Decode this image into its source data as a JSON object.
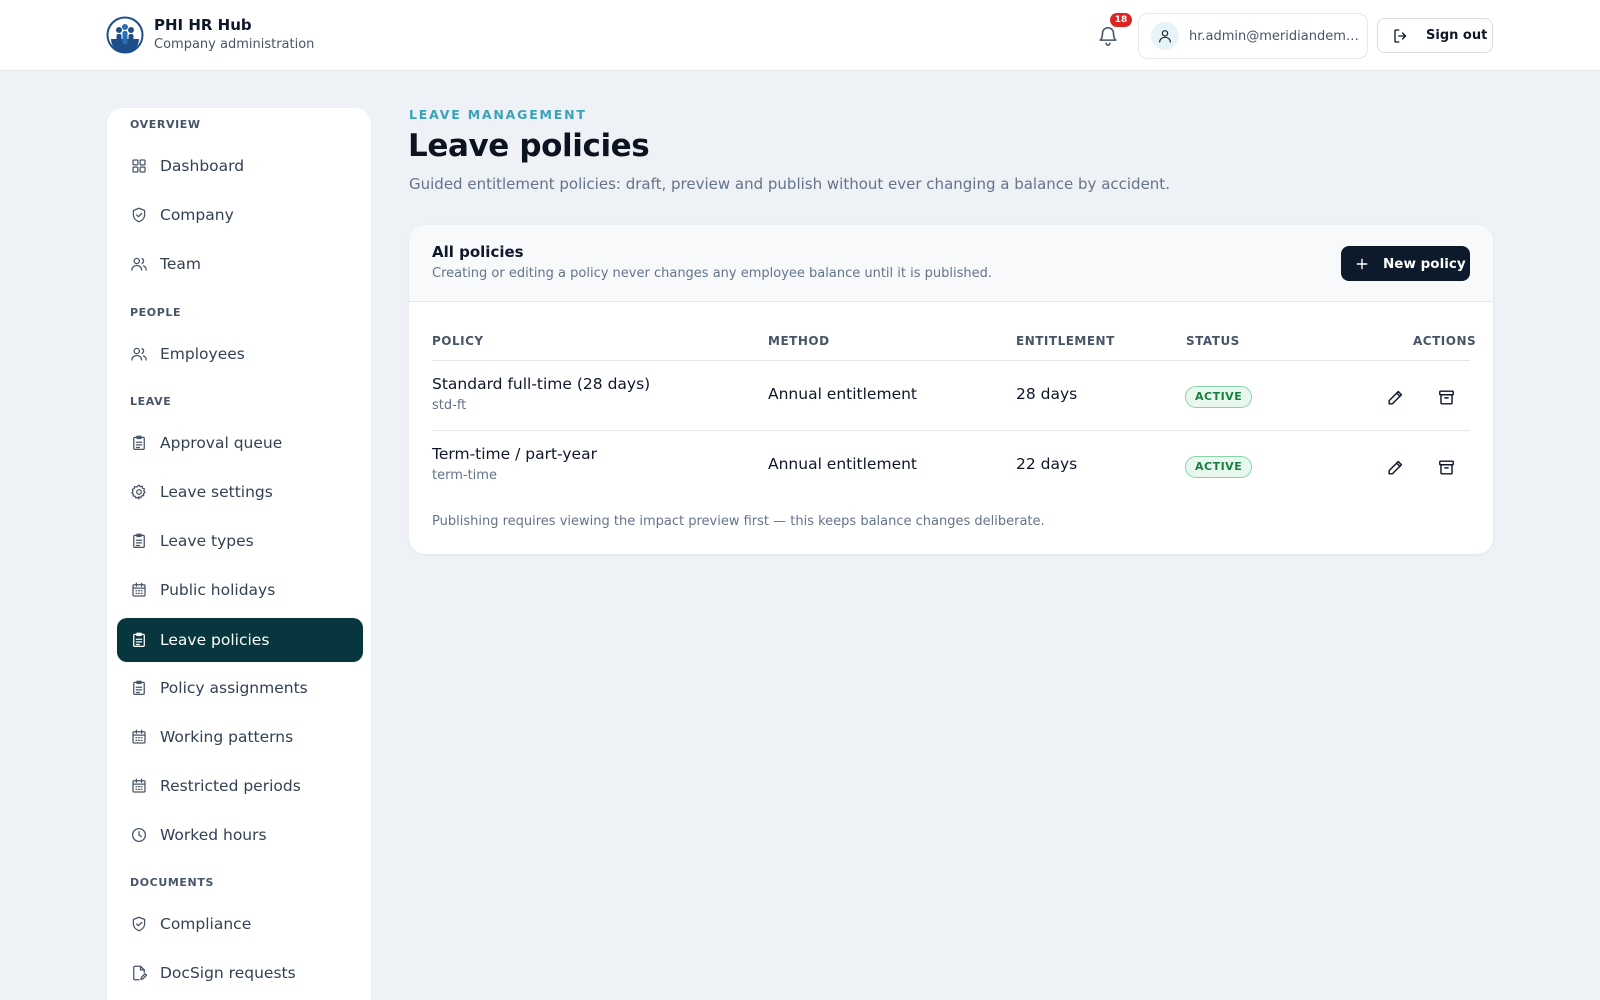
{
  "app": {
    "name": "PHI HR Hub",
    "subtitle": "Company administration"
  },
  "header": {
    "notification_count": "18",
    "account_email": "hr.admin@meridiandemo.co.uk",
    "sign_out_label": "Sign out"
  },
  "sidebar": {
    "sections": [
      {
        "label": "OVERVIEW"
      },
      {
        "label": "PEOPLE"
      },
      {
        "label": "LEAVE"
      },
      {
        "label": "DOCUMENTS"
      }
    ],
    "items": [
      {
        "label": "Dashboard",
        "icon": "grid-icon"
      },
      {
        "label": "Company",
        "icon": "shield-icon"
      },
      {
        "label": "Team",
        "icon": "users-icon"
      },
      {
        "label": "Employees",
        "icon": "users-icon"
      },
      {
        "label": "Approval queue",
        "icon": "clipboard-icon"
      },
      {
        "label": "Leave settings",
        "icon": "gear-icon"
      },
      {
        "label": "Leave types",
        "icon": "clipboard-icon"
      },
      {
        "label": "Public holidays",
        "icon": "calendar-icon"
      },
      {
        "label": "Leave policies",
        "icon": "clipboard-icon",
        "active": true
      },
      {
        "label": "Policy assignments",
        "icon": "clipboard-icon"
      },
      {
        "label": "Working patterns",
        "icon": "calendar-icon"
      },
      {
        "label": "Restricted periods",
        "icon": "calendar-icon"
      },
      {
        "label": "Worked hours",
        "icon": "clock-icon"
      },
      {
        "label": "Compliance",
        "icon": "shield-icon"
      },
      {
        "label": "DocSign requests",
        "icon": "document-sign-icon"
      }
    ],
    "active_color": "#07363f"
  },
  "main": {
    "eyebrow": "LEAVE MANAGEMENT",
    "title": "Leave policies",
    "description": "Guided entitlement policies: draft, preview and publish without ever changing a balance by accident."
  },
  "policies_card": {
    "title": "All policies",
    "subtitle": "Creating or editing a policy never changes any employee balance until it is published.",
    "new_button_label": "New policy",
    "columns": [
      "POLICY",
      "METHOD",
      "ENTITLEMENT",
      "STATUS",
      "ACTIONS"
    ],
    "rows": [
      {
        "name": "Standard full-time (28 days)",
        "code": "std-ft",
        "method": "Annual entitlement",
        "entitlement": "28 days",
        "status": "ACTIVE"
      },
      {
        "name": "Term-time / part-year",
        "code": "term-time",
        "method": "Annual entitlement",
        "entitlement": "22 days",
        "status": "ACTIVE"
      }
    ],
    "footer_note": "Publishing requires viewing the impact preview first — this keeps balance changes deliberate."
  },
  "colors": {
    "accent": "#3aa3b5",
    "primary_button": "#0c1a2b",
    "status_active": "#15803d",
    "badge_red": "#dc2626"
  }
}
